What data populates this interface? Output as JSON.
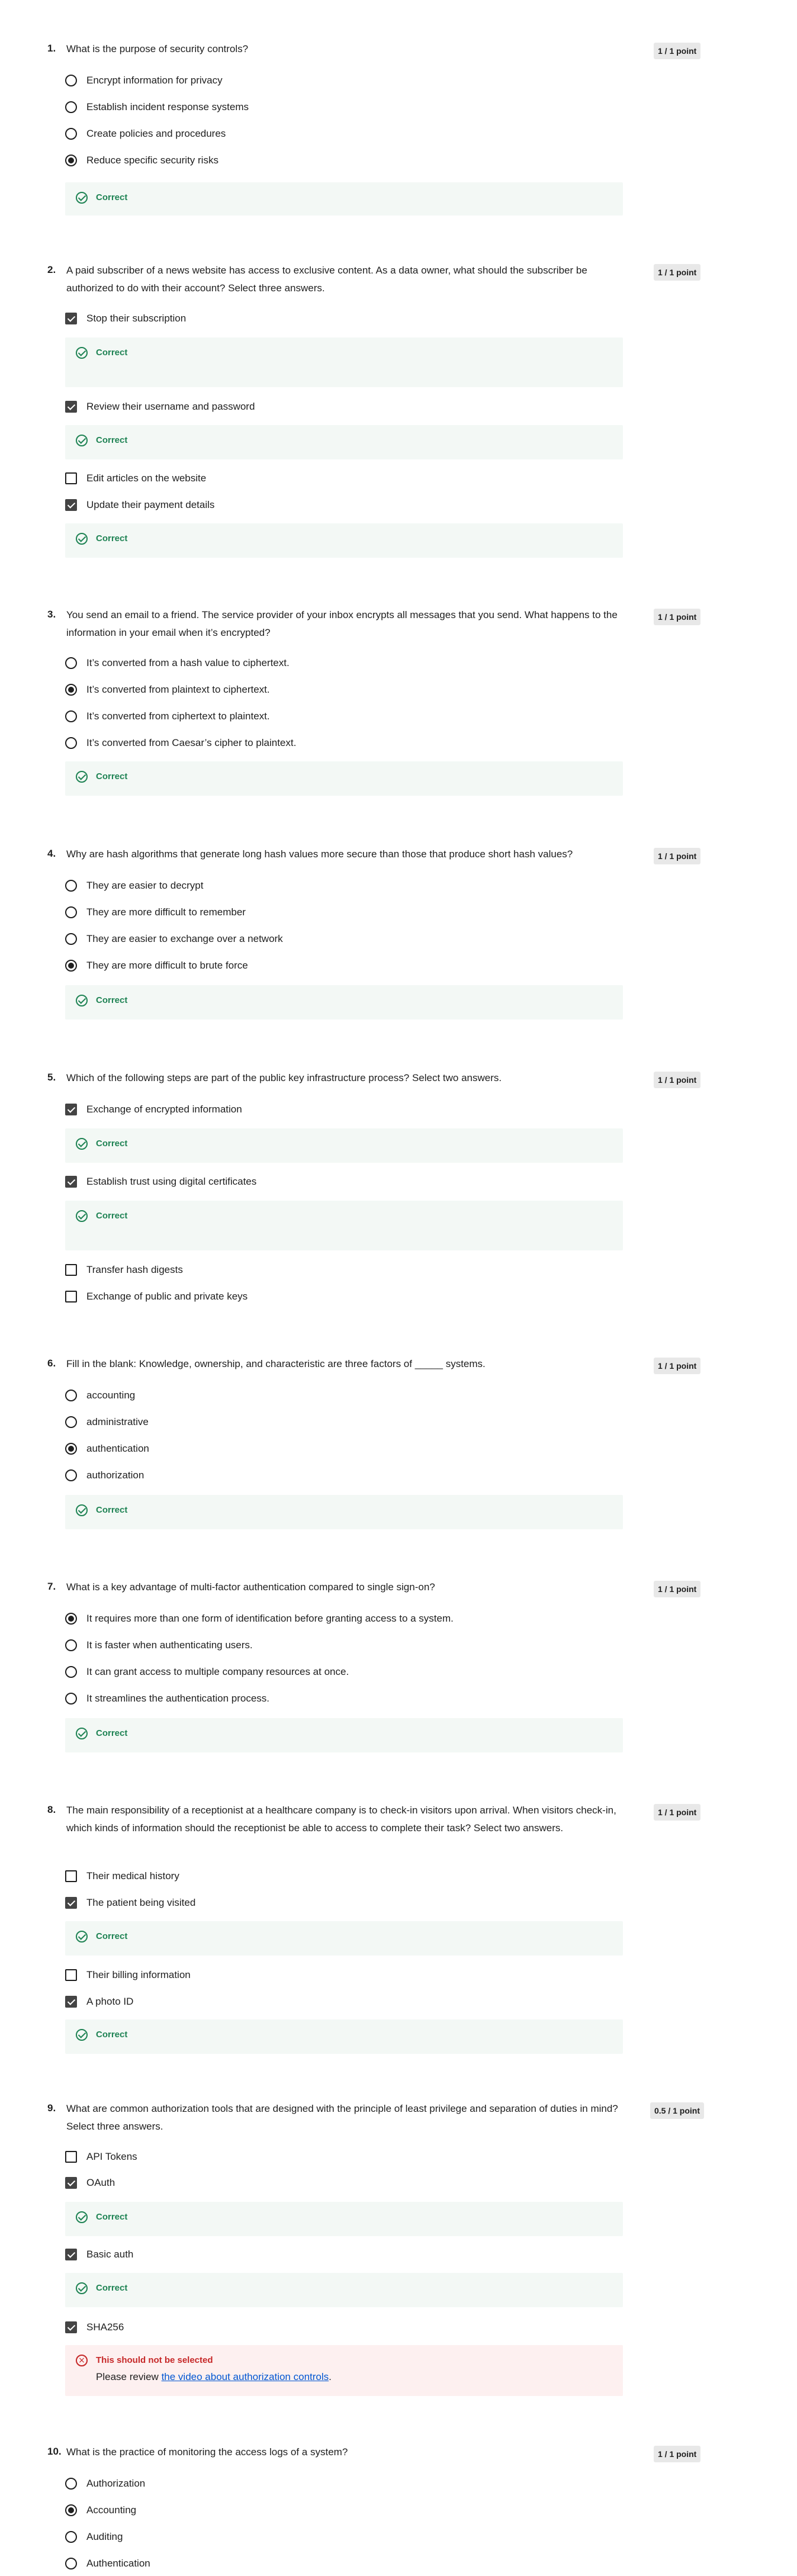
{
  "feedback": {
    "correct": "Correct",
    "incorrect": "This should not be selected",
    "review_prefix": "Please review ",
    "review_link": "the video about authorization controls",
    "review_suffix": "."
  },
  "questions": [
    {
      "number": "1.",
      "text": "What is the purpose of security controls?",
      "points": "1 / 1 point",
      "type": "radio",
      "options": [
        {
          "label": "Encrypt information for privacy",
          "selected": false
        },
        {
          "label": "Establish incident response systems",
          "selected": false
        },
        {
          "label": "Create policies and procedures",
          "selected": false
        },
        {
          "label": "Reduce specific security risks",
          "selected": true
        }
      ]
    },
    {
      "number": "2.",
      "text": "A paid subscriber of a news website has access to exclusive content. As a data owner, what should the subscriber be authorized to do with their account? Select three answers.",
      "points": "1 / 1 point",
      "type": "checkbox",
      "options": [
        {
          "label": "Stop their subscription",
          "selected": true
        },
        {
          "label": "Review their username and password",
          "selected": true
        },
        {
          "label": "Edit articles on the website",
          "selected": false
        },
        {
          "label": "Update their payment details",
          "selected": true
        }
      ]
    },
    {
      "number": "3.",
      "text": "You send an email to a friend. The service provider of your inbox encrypts all messages that you send. What happens to the information in your email when it’s encrypted?",
      "points": "1 / 1 point",
      "type": "radio",
      "options": [
        {
          "label": "It’s converted from a hash value to ciphertext.",
          "selected": false
        },
        {
          "label": "It’s converted from plaintext to ciphertext.",
          "selected": true
        },
        {
          "label": "It’s converted from ciphertext to plaintext.",
          "selected": false
        },
        {
          "label": "It’s converted from Caesar’s cipher to plaintext.",
          "selected": false
        }
      ]
    },
    {
      "number": "4.",
      "text": "Why are hash algorithms that generate long hash values more secure than those that produce short hash values?",
      "points": "1 / 1 point",
      "type": "radio",
      "options": [
        {
          "label": "They are easier to decrypt",
          "selected": false
        },
        {
          "label": "They are more difficult to remember",
          "selected": false
        },
        {
          "label": "They are easier to exchange over a network",
          "selected": false
        },
        {
          "label": "They are more difficult to brute force",
          "selected": true
        }
      ]
    },
    {
      "number": "5.",
      "text": "Which of the following steps are part of the public key infrastructure process? Select two answers.",
      "points": "1 / 1 point",
      "type": "checkbox",
      "options": [
        {
          "label": "Exchange of encrypted information",
          "selected": true
        },
        {
          "label": "Establish trust using digital certificates",
          "selected": true
        },
        {
          "label": "Transfer hash digests",
          "selected": false
        },
        {
          "label": "Exchange of public and private keys",
          "selected": false
        }
      ]
    },
    {
      "number": "6.",
      "text": "Fill in the blank: Knowledge, ownership, and characteristic are three factors of _____ systems.",
      "points": "1 / 1 point",
      "type": "radio",
      "options": [
        {
          "label": "accounting",
          "selected": false
        },
        {
          "label": "administrative",
          "selected": false
        },
        {
          "label": "authentication",
          "selected": true
        },
        {
          "label": "authorization",
          "selected": false
        }
      ]
    },
    {
      "number": "7.",
      "text": "What is a key advantage of multi-factor authentication compared to single sign-on?",
      "points": "1 / 1 point",
      "type": "radio",
      "options": [
        {
          "label": "It requires more than one form of identification before granting access to a system.",
          "selected": true
        },
        {
          "label": "It is faster when authenticating users.",
          "selected": false
        },
        {
          "label": "It can grant access to multiple company resources at once.",
          "selected": false
        },
        {
          "label": "It streamlines the authentication process.",
          "selected": false
        }
      ]
    },
    {
      "number": "8.",
      "text": "The main responsibility of a receptionist at a healthcare company is to check-in visitors upon arrival. When visitors check-in, which kinds of information should the receptionist be able to access to complete their task? Select two answers.",
      "points": "1 / 1 point",
      "type": "checkbox",
      "options": [
        {
          "label": "Their medical history",
          "selected": false
        },
        {
          "label": "The patient being visited",
          "selected": true
        },
        {
          "label": "Their billing information",
          "selected": false
        },
        {
          "label": "A photo ID",
          "selected": true
        }
      ]
    },
    {
      "number": "9.",
      "text": "What are common authorization tools that are designed with the principle of least privilege and separation of duties in mind? Select three answers.",
      "points": "0.5 / 1 point",
      "type": "checkbox",
      "options": [
        {
          "label": "API Tokens",
          "selected": false
        },
        {
          "label": "OAuth",
          "selected": true
        },
        {
          "label": "Basic auth",
          "selected": true
        },
        {
          "label": "SHA256",
          "selected": true
        }
      ]
    },
    {
      "number": "10.",
      "text": "What is the practice of monitoring the access logs of a system?",
      "points": "1 / 1 point",
      "type": "radio",
      "options": [
        {
          "label": "Authorization",
          "selected": false
        },
        {
          "label": "Accounting",
          "selected": true
        },
        {
          "label": "Auditing",
          "selected": false
        },
        {
          "label": "Authentication",
          "selected": false
        }
      ]
    }
  ]
}
